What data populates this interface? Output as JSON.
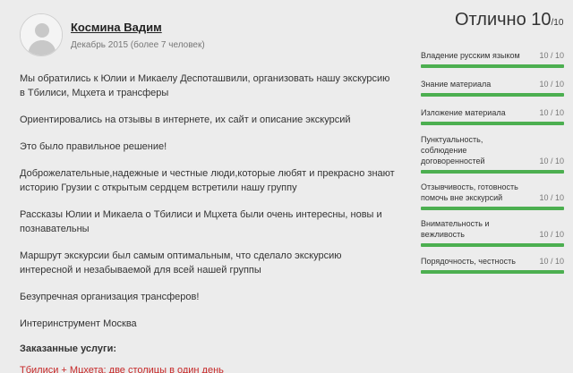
{
  "review": {
    "author": "Космина Вадим",
    "meta": "Декабрь 2015 (более 7 человек)",
    "paragraphs": [
      "Мы обратились к Юлии и Микаелу Деспоташвили, организовать нашу экскурсию в Тбилиси, Мцхета и трансферы",
      "Ориентировались на отзывы в интернете, их сайт и описание экскурсий",
      "Это было правильное решение!",
      "Доброжелательные,надежные и честные люди,которые любят и прекрасно знают историю Грузии с открытым сердцем встретили нашу группу",
      "Рассказы Юлии и Микаела о Тбилиси и Мцхета были очень интересны, новы и познавательны",
      "Маршрут экскурсии был самым оптимальным, что сделало экскурсию интересной и незабываемой для всей нашей группы",
      "Безупречная организация трансферов!",
      "Интеринструмент Москва"
    ],
    "services_title": "Заказанные услуги:",
    "service_link": "Тбилиси + Мцхета: две столицы в один день"
  },
  "rating": {
    "label": "Отлично",
    "score": "10",
    "max": "/10",
    "criteria": [
      {
        "label": "Владение русским языком",
        "score": "10 / 10",
        "value": 1.0
      },
      {
        "label": "Знание материала",
        "score": "10 / 10",
        "value": 1.0
      },
      {
        "label": "Изложение материала",
        "score": "10 / 10",
        "value": 1.0
      },
      {
        "label": "Пунктуальность, соблюдение договоренностей",
        "score": "10 / 10",
        "value": 1.0
      },
      {
        "label": "Отзывчивость, готовность помочь вне экскурсий",
        "score": "10 / 10",
        "value": 1.0
      },
      {
        "label": "Внимательность и вежливость",
        "score": "10 / 10",
        "value": 1.0
      },
      {
        "label": "Порядочность, честность",
        "score": "10 / 10",
        "value": 1.0
      }
    ]
  },
  "colors": {
    "bar_fill": "#4caf50",
    "link": "#c62828",
    "background": "#ececec"
  },
  "icons": {
    "avatar": "user-silhouette-icon"
  }
}
